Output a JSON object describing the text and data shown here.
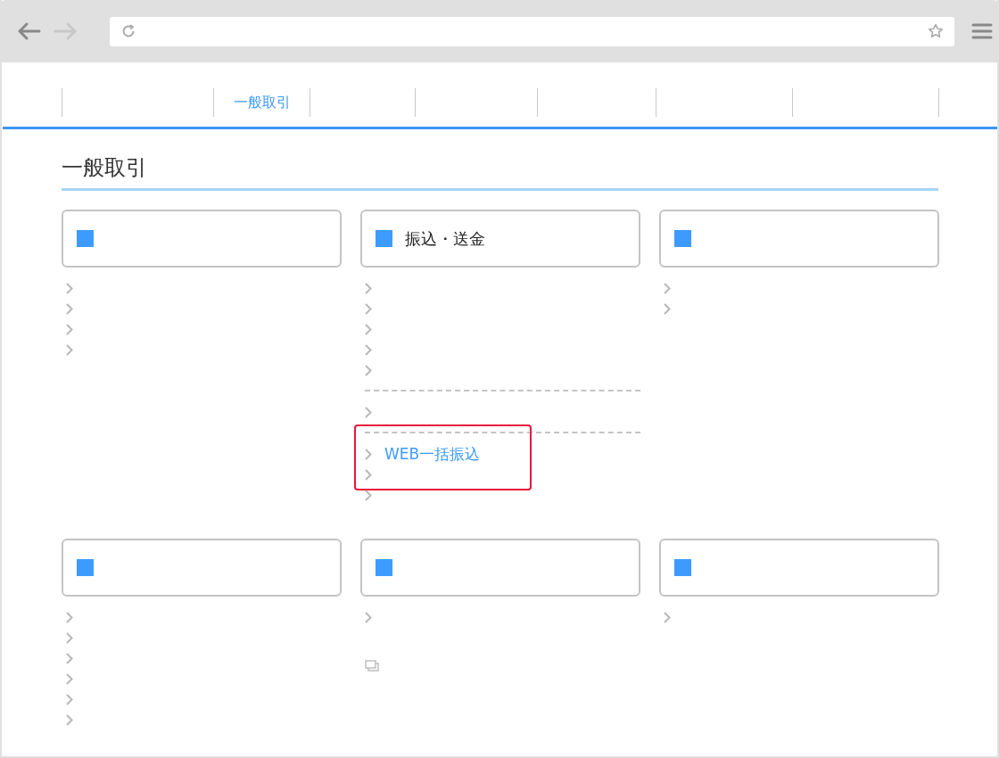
{
  "nav": {
    "tabs": [
      {
        "label": "一般取引",
        "selected": true
      }
    ]
  },
  "heading": "一般取引",
  "cards": [
    {
      "groups": [
        {
          "links": [
            {
              "kind": "internal",
              "highlighted": false
            },
            {
              "kind": "internal",
              "highlighted": false
            },
            {
              "kind": "internal",
              "highlighted": false
            },
            {
              "kind": "internal",
              "highlighted": false
            }
          ]
        }
      ]
    },
    {
      "title": "振込・送金",
      "groups": [
        {
          "links": [
            {
              "kind": "internal",
              "highlighted": false
            },
            {
              "kind": "internal",
              "highlighted": false
            },
            {
              "kind": "internal",
              "highlighted": false
            },
            {
              "kind": "internal",
              "highlighted": false
            },
            {
              "kind": "internal",
              "highlighted": false
            }
          ]
        },
        {
          "links": [
            {
              "kind": "internal",
              "highlighted": false
            }
          ]
        },
        {
          "links": [
            {
              "kind": "internal",
              "label": "WEB一括振込",
              "highlighted": true
            },
            {
              "kind": "internal",
              "highlighted": false
            },
            {
              "kind": "internal",
              "highlighted": false
            }
          ]
        }
      ]
    },
    {
      "groups": [
        {
          "links": [
            {
              "kind": "internal",
              "highlighted": false
            },
            {
              "kind": "internal",
              "highlighted": false
            }
          ]
        }
      ]
    },
    {
      "groups": [
        {
          "links": [
            {
              "kind": "internal",
              "highlighted": false
            },
            {
              "kind": "internal",
              "highlighted": false
            },
            {
              "kind": "internal",
              "highlighted": false
            },
            {
              "kind": "internal",
              "highlighted": false
            },
            {
              "kind": "internal",
              "highlighted": false
            },
            {
              "kind": "internal",
              "highlighted": false
            }
          ]
        }
      ]
    },
    {
      "groups": [
        {
          "links": [
            {
              "kind": "internal",
              "highlighted": false
            },
            {
              "kind": "external",
              "highlighted": false
            }
          ]
        }
      ]
    },
    {
      "groups": [
        {
          "links": [
            {
              "kind": "internal",
              "highlighted": false
            }
          ]
        }
      ]
    }
  ]
}
